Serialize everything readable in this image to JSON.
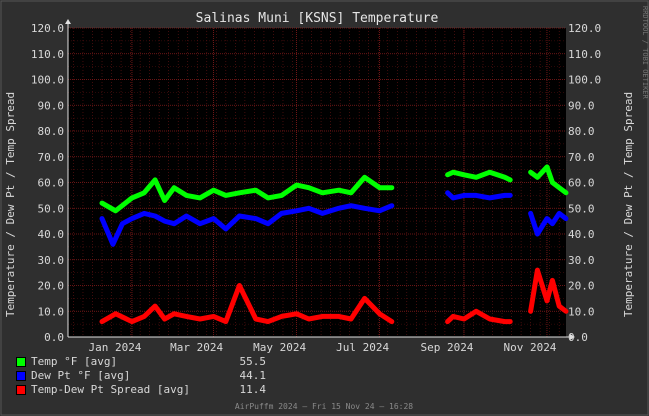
{
  "chart_data": {
    "type": "line",
    "title": "Salinas Muni [KSNS] Temperature",
    "ylabel": "Temperature / Dew Pt / Temp Spread",
    "ylim": [
      0,
      120
    ],
    "yticks": [
      "0.0",
      "10.0",
      "20.0",
      "30.0",
      "40.0",
      "50.0",
      "60.0",
      "70.0",
      "80.0",
      "90.0",
      "100.0",
      "110.0",
      "120.0"
    ],
    "xticks": [
      "Jan 2024",
      "Mar 2024",
      "May 2024",
      "Jul 2024",
      "Sep 2024",
      "Nov 2024"
    ],
    "xtick_dates": [
      "2024-01-01",
      "2024-03-01",
      "2024-05-01",
      "2024-07-01",
      "2024-09-01",
      "2024-11-01"
    ],
    "xrange": [
      "2023-11-15",
      "2024-11-15"
    ],
    "grid": true,
    "side_text": "RRDTOOL / TOBI OETIKER",
    "footer": "AirPuffm 2024 – Fri 15 Nov 24 – 16:28",
    "series": [
      {
        "name": "Temp °F [avg]",
        "color": "#00ff00",
        "avg": "55.5",
        "segments": [
          {
            "x": [
              "2023-12-10",
              "2023-12-20",
              "2024-01-01",
              "2024-01-10",
              "2024-01-18",
              "2024-01-25",
              "2024-02-01",
              "2024-02-10",
              "2024-02-20",
              "2024-03-01",
              "2024-03-10",
              "2024-03-20",
              "2024-04-01",
              "2024-04-10",
              "2024-04-20",
              "2024-05-01",
              "2024-05-10",
              "2024-05-20",
              "2024-06-01",
              "2024-06-10",
              "2024-06-20",
              "2024-07-01",
              "2024-07-10"
            ],
            "y": [
              52,
              49,
              54,
              56,
              61,
              53,
              58,
              55,
              54,
              57,
              55,
              56,
              57,
              54,
              55,
              59,
              58,
              56,
              57,
              56,
              62,
              58,
              58
            ]
          },
          {
            "x": [
              "2024-08-20",
              "2024-08-24",
              "2024-09-01",
              "2024-09-10",
              "2024-09-20",
              "2024-10-01",
              "2024-10-05"
            ],
            "y": [
              63,
              64,
              63,
              62,
              64,
              62,
              61
            ]
          },
          {
            "x": [
              "2024-10-20",
              "2024-10-25",
              "2024-11-01",
              "2024-11-05",
              "2024-11-10",
              "2024-11-15"
            ],
            "y": [
              64,
              62,
              66,
              60,
              58,
              56
            ]
          }
        ]
      },
      {
        "name": "Dew Pt °F [avg]",
        "color": "#0000ff",
        "avg": "44.1",
        "segments": [
          {
            "x": [
              "2023-12-10",
              "2023-12-18",
              "2023-12-25",
              "2024-01-01",
              "2024-01-10",
              "2024-01-18",
              "2024-01-25",
              "2024-02-01",
              "2024-02-10",
              "2024-02-20",
              "2024-03-01",
              "2024-03-10",
              "2024-03-20",
              "2024-04-01",
              "2024-04-10",
              "2024-04-20",
              "2024-05-01",
              "2024-05-10",
              "2024-05-20",
              "2024-06-01",
              "2024-06-10",
              "2024-06-20",
              "2024-07-01",
              "2024-07-10"
            ],
            "y": [
              46,
              36,
              44,
              46,
              48,
              47,
              45,
              44,
              47,
              44,
              46,
              42,
              47,
              46,
              44,
              48,
              49,
              50,
              48,
              50,
              51,
              50,
              49,
              51
            ]
          },
          {
            "x": [
              "2024-08-20",
              "2024-08-24",
              "2024-09-01",
              "2024-09-10",
              "2024-09-20",
              "2024-10-01",
              "2024-10-05"
            ],
            "y": [
              56,
              54,
              55,
              55,
              54,
              55,
              55
            ]
          },
          {
            "x": [
              "2024-10-20",
              "2024-10-25",
              "2024-11-01",
              "2024-11-05",
              "2024-11-10",
              "2024-11-15"
            ],
            "y": [
              48,
              40,
              46,
              44,
              48,
              46
            ]
          }
        ]
      },
      {
        "name": "Temp-Dew Pt Spread [avg]",
        "color": "#ff0000",
        "avg": "11.4",
        "segments": [
          {
            "x": [
              "2023-12-10",
              "2023-12-20",
              "2024-01-01",
              "2024-01-10",
              "2024-01-18",
              "2024-01-25",
              "2024-02-01",
              "2024-02-10",
              "2024-02-20",
              "2024-03-01",
              "2024-03-10",
              "2024-03-20",
              "2024-04-01",
              "2024-04-10",
              "2024-04-20",
              "2024-05-01",
              "2024-05-10",
              "2024-05-20",
              "2024-06-01",
              "2024-06-10",
              "2024-06-20",
              "2024-07-01",
              "2024-07-10"
            ],
            "y": [
              6,
              9,
              6,
              8,
              12,
              7,
              9,
              8,
              7,
              8,
              6,
              20,
              7,
              6,
              8,
              9,
              7,
              8,
              8,
              7,
              15,
              9,
              6
            ]
          },
          {
            "x": [
              "2024-08-20",
              "2024-08-24",
              "2024-09-01",
              "2024-09-10",
              "2024-09-20",
              "2024-10-01",
              "2024-10-05"
            ],
            "y": [
              6,
              8,
              7,
              10,
              7,
              6,
              6
            ]
          },
          {
            "x": [
              "2024-10-20",
              "2024-10-25",
              "2024-11-01",
              "2024-11-05",
              "2024-11-10",
              "2024-11-15"
            ],
            "y": [
              10,
              26,
              14,
              22,
              12,
              10
            ]
          }
        ]
      }
    ]
  }
}
